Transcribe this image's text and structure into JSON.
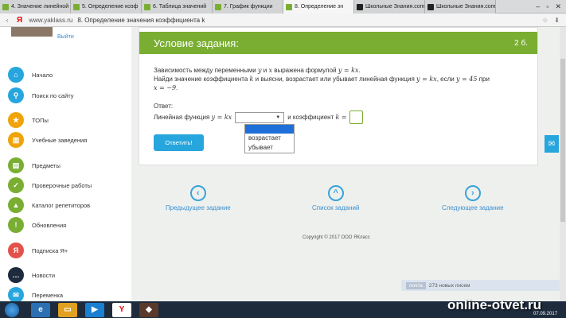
{
  "browser": {
    "tabs": [
      {
        "label": "4. Значение линейной",
        "color": "#7aae33"
      },
      {
        "label": "5. Определение коэф",
        "color": "#7aae33"
      },
      {
        "label": "6. Таблица значений",
        "color": "#7aae33"
      },
      {
        "label": "7. График функции",
        "color": "#7aae33"
      },
      {
        "label": "8. Определение зн",
        "color": "#7aae33"
      },
      {
        "label": "Школьные Знания.com",
        "color": "#222"
      },
      {
        "label": "Школьные Знания.com",
        "color": "#222"
      }
    ],
    "url": "www.yaklass.ru",
    "page_title": "8. Определение значения коэффициента k"
  },
  "sidebar": {
    "logout": "Выйти",
    "items": [
      {
        "label": "Начало",
        "icon": "home-icon",
        "color": "#27a6de"
      },
      {
        "label": "Поиск по сайту",
        "icon": "search-icon",
        "color": "#27a6de"
      },
      {
        "label": "ТОПы",
        "icon": "star-icon",
        "color": "#f0a30a"
      },
      {
        "label": "Учебные заведения",
        "icon": "school-icon",
        "color": "#f0a30a"
      },
      {
        "label": "Предметы",
        "icon": "book-icon",
        "color": "#7aae33"
      },
      {
        "label": "Проверочные работы",
        "icon": "check-icon",
        "color": "#7aae33"
      },
      {
        "label": "Каталог репетиторов",
        "icon": "cap-icon",
        "color": "#7aae33"
      },
      {
        "label": "Обновления",
        "icon": "info-icon",
        "color": "#7aae33"
      },
      {
        "label": "Подписка Я+",
        "icon": "plus-icon",
        "color": "#e2524a"
      },
      {
        "label": "Новости",
        "icon": "chat-icon",
        "color": "#1d2b3d"
      },
      {
        "label": "Переменка",
        "icon": "mail-icon",
        "color": "#27a6de"
      }
    ]
  },
  "task": {
    "title": "Условие задания:",
    "points": "2 б.",
    "line1_pre": "Зависимость между переменными",
    "var_y": "y",
    "and": "и",
    "var_x": "x",
    "line1_mid": "выражена формулой",
    "formula": "y = kx",
    "line2_pre": "Найди значение коэффициента",
    "var_k": "k",
    "line2_mid": "и выясни, возрастает или убывает линейная функция",
    "line2_if": ", если",
    "cond_y": "y = 45",
    "line2_at": "при",
    "cond_x": "x = −9",
    "answer_label": "Ответ:",
    "linear_label": "Линейная функция",
    "coef_label": "коэффициент",
    "coef_var": "k =",
    "dropdown_options": [
      "",
      "возрастает",
      "убывает"
    ],
    "submit": "Ответить!"
  },
  "navigation": {
    "prev": "Предыдущее задание",
    "list": "Список заданий",
    "next": "Следующее задание"
  },
  "footer": {
    "copyright": "Copyright © 2017 ООО ЯКласс",
    "mail_badge": "почта",
    "mail_text": "273 новых писем"
  },
  "watermark": "online-otvet.ru",
  "date": "07.09.2017"
}
